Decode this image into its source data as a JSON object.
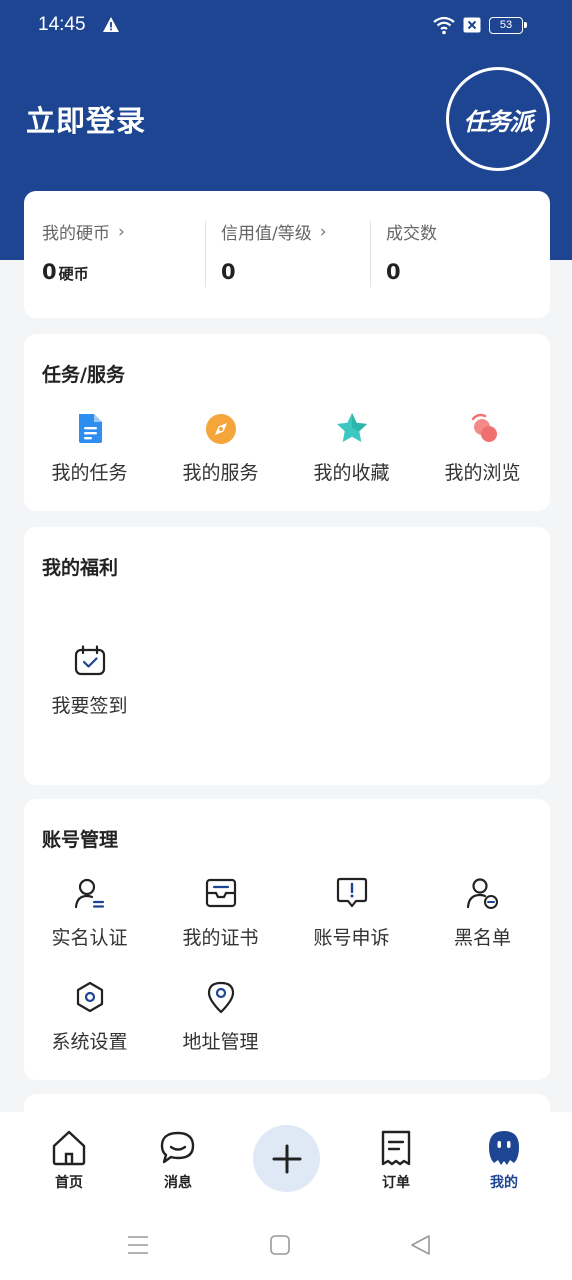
{
  "status_bar": {
    "time": "14:45",
    "battery": "53"
  },
  "header": {
    "login_title": "立即登录",
    "logo_text": "任务派"
  },
  "stats": [
    {
      "label": "我的硬币",
      "chevron": "›",
      "value": "0",
      "unit": "硬币"
    },
    {
      "label": "信用值/等级",
      "chevron": "›",
      "value": "0",
      "unit": ""
    },
    {
      "label": "成交数",
      "chevron": "",
      "value": "0",
      "unit": ""
    }
  ],
  "tasks_section": {
    "title": "任务/服务",
    "items": [
      {
        "label": "我的任务",
        "icon": "document-icon",
        "color": "#2d8ef0"
      },
      {
        "label": "我的服务",
        "icon": "compass-icon",
        "color": "#f5a63a"
      },
      {
        "label": "我的收藏",
        "icon": "star-icon",
        "color": "#3cc8c0"
      },
      {
        "label": "我的浏览",
        "icon": "browse-icon",
        "color": "#f07070"
      }
    ]
  },
  "benefits_section": {
    "title": "我的福利",
    "items": [
      {
        "label": "我要签到",
        "icon": "calendar-check-icon"
      }
    ]
  },
  "account_section": {
    "title": "账号管理",
    "items": [
      {
        "label": "实名认证",
        "icon": "user-verify-icon"
      },
      {
        "label": "我的证书",
        "icon": "certificate-icon"
      },
      {
        "label": "账号申诉",
        "icon": "appeal-icon"
      },
      {
        "label": "黑名单",
        "icon": "blacklist-icon"
      },
      {
        "label": "系统设置",
        "icon": "settings-icon"
      },
      {
        "label": "地址管理",
        "icon": "location-icon"
      }
    ]
  },
  "bottom_nav": {
    "items": [
      {
        "label": "首页",
        "icon": "home-icon"
      },
      {
        "label": "消息",
        "icon": "message-icon"
      },
      {
        "label": "订单",
        "icon": "order-icon"
      },
      {
        "label": "我的",
        "icon": "profile-icon",
        "active": true
      }
    ],
    "add_icon": "plus-icon"
  },
  "colors": {
    "brand": "#1e4592",
    "background": "#f4f5f7"
  }
}
